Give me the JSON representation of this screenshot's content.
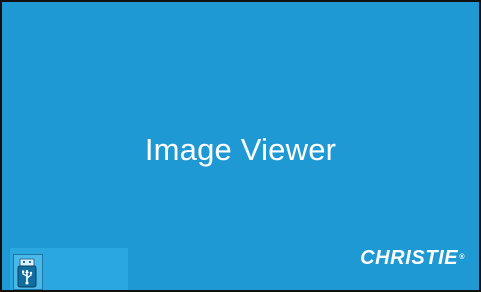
{
  "screen": {
    "title": "Image Viewer",
    "background_color": "#1f99d3"
  },
  "usb_source": {
    "icon": "usb-drive-icon"
  },
  "brand": {
    "logo_text": "CHRISTIE",
    "trademark": "®"
  }
}
